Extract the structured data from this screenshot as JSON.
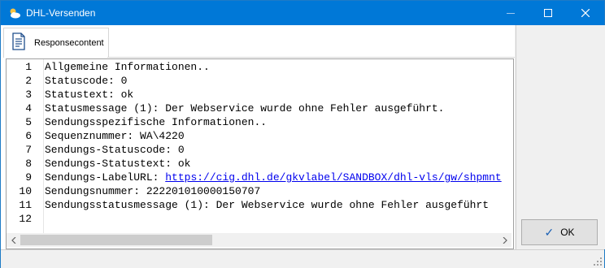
{
  "window": {
    "title": "DHL-Versenden",
    "icon": "cloud-sun-icon",
    "controls": {
      "minimize": "minimize-icon",
      "maximize": "maximize-icon",
      "close": "close-icon"
    }
  },
  "tabs": [
    {
      "label": "Responsecontent",
      "icon": "document-icon"
    }
  ],
  "editor": {
    "lines": [
      {
        "num": "1",
        "text": "Allgemeine Informationen.."
      },
      {
        "num": "2",
        "text": "Statuscode: 0"
      },
      {
        "num": "3",
        "text": "Statustext: ok"
      },
      {
        "num": "4",
        "text": "Statusmessage (1): Der Webservice wurde ohne Fehler ausgeführt."
      },
      {
        "num": "5",
        "text": "Sendungsspezifische Informationen.."
      },
      {
        "num": "6",
        "text": "Sequenznummer: WA\\4220"
      },
      {
        "num": "7",
        "text": "Sendungs-Statuscode: 0"
      },
      {
        "num": "8",
        "text": "Sendungs-Statustext: ok"
      },
      {
        "num": "9",
        "text": "Sendungs-LabelURL: ",
        "link": "https://cig.dhl.de/gkvlabel/SANDBOX/dhl-vls/gw/shpmnt"
      },
      {
        "num": "10",
        "text": "Sendungsnummer: 222201010000150707"
      },
      {
        "num": "11",
        "text": "Sendungsstatusmessage (1): Der Webservice wurde ohne Fehler ausgeführt"
      },
      {
        "num": "12",
        "text": ""
      }
    ]
  },
  "buttons": {
    "ok_label": "OK"
  }
}
